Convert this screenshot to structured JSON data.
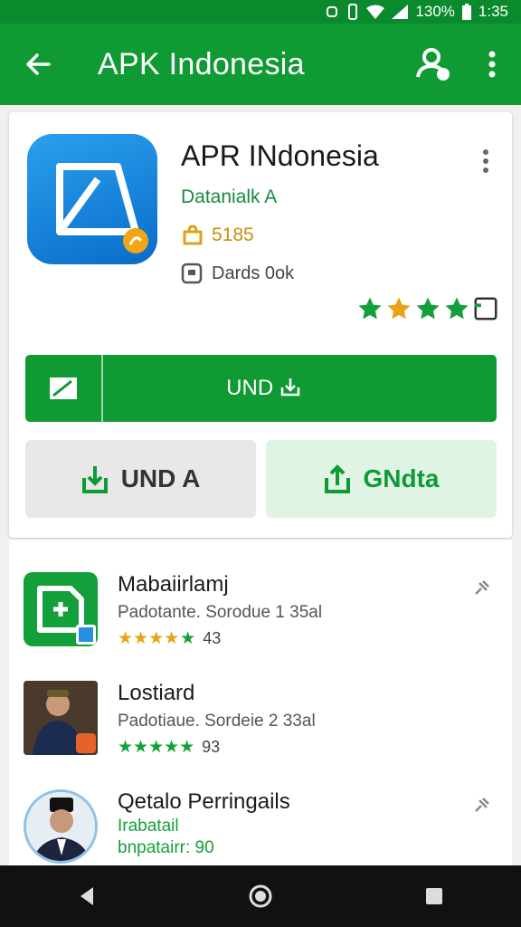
{
  "status": {
    "battery": "130%",
    "time": "1:35"
  },
  "appbar": {
    "title": "APK Indonesia"
  },
  "app": {
    "title": "APR INdonesia",
    "developer": "Datanialk A",
    "download_count": "5185",
    "content_rating": "Dards 0ok",
    "rating_stars": 4,
    "install_label": "UND",
    "left_button_label": "UND A",
    "right_button_label": "GNdta"
  },
  "related": [
    {
      "name": "Mabaiirlamj",
      "subtitle": "Padotante. Sorodue 1 35al",
      "rating": "43",
      "star_color": "#e8a317"
    },
    {
      "name": "Lostiard",
      "subtitle": "Padotiaue. Sordeie 2 33al",
      "rating": "93",
      "star_color": "#13a03a"
    },
    {
      "name": "Qetalo Perringails",
      "subtitle": "Irabatail",
      "rating_line": "bnpatairr: 90",
      "star_color": "#13a03a"
    }
  ],
  "colors": {
    "primary": "#109a34",
    "primary_dark": "#0a8a2c",
    "star_gold": "#e8a317",
    "star_green": "#13a03a"
  }
}
